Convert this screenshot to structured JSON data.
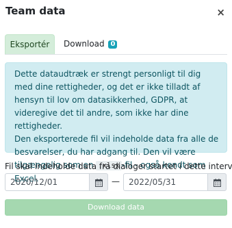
{
  "dialog": {
    "title": "Team data",
    "close_glyph": "×",
    "close_icon": "close-icon"
  },
  "tabs": [
    {
      "label": "Eksportér",
      "active": true
    },
    {
      "label": "Download",
      "badge": "0",
      "active": false
    }
  ],
  "info": {
    "paragraph1": "Dette dataudtræk er strengt personligt til dig med dine rettigheder, og det er ikke tilladt af hensyn til lov om datasikkerhed, GDPR, at videregive det til andre, som ikke har dine rettigheder.",
    "paragraph2_before": "Den eksporterede fil vil indeholde data fra alle de besvarelser, du har adgang til. Den vil være tilgængelig som en ",
    "paragraph2_code": ".xlsx",
    "paragraph2_after": "-fil - også kendt som Excel."
  },
  "interval": {
    "label": "Fil skal indeholde data fra dialoger startet i dette interval",
    "from": "2020/12/01",
    "separator": "—",
    "to": "2022/05/31",
    "calendar_icon": "calendar-icon"
  },
  "download_button": {
    "label": "Download data"
  },
  "colors": {
    "active_tab_bg": "#d4edda",
    "info_bg": "#d1ecf1",
    "info_text": "#0c5460",
    "badge_bg": "#17a2b8",
    "download_bg": "#a5d8b0"
  }
}
